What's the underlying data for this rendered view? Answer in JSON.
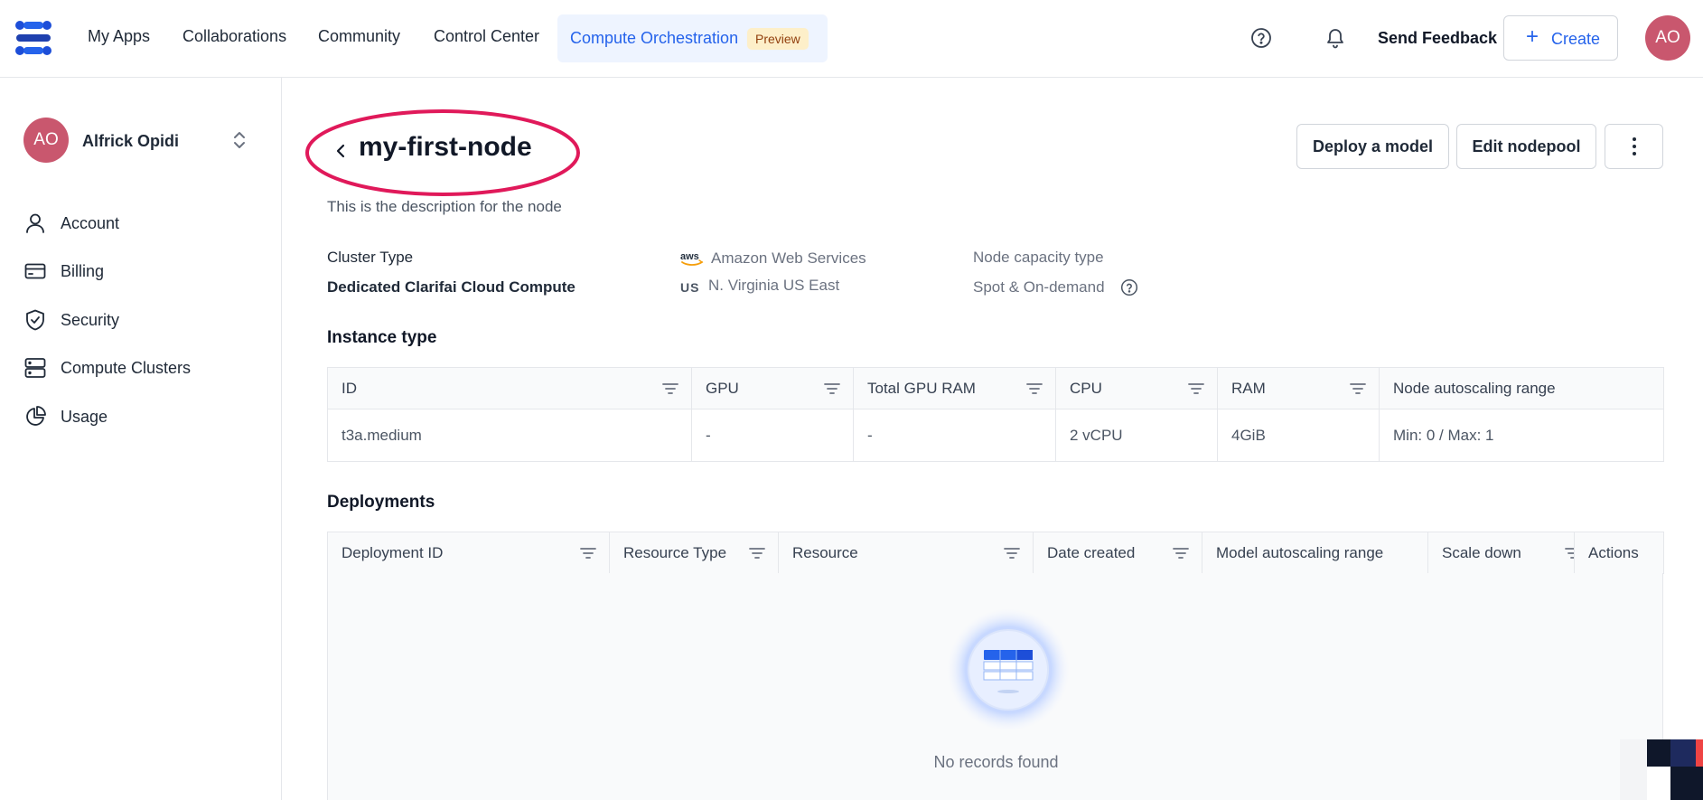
{
  "topnav": {
    "items": [
      "My Apps",
      "Collaborations",
      "Community",
      "Control Center"
    ],
    "active_item": "Compute Orchestration",
    "active_badge": "Preview",
    "send_feedback": "Send Feedback",
    "create_label": "Create",
    "avatar_initials": "AO"
  },
  "sidebar": {
    "avatar_initials": "AO",
    "user_name": "Alfrick Opidi",
    "items": [
      {
        "label": "Account",
        "icon": "user-icon"
      },
      {
        "label": "Billing",
        "icon": "credit-card-icon"
      },
      {
        "label": "Security",
        "icon": "shield-check-icon"
      },
      {
        "label": "Compute Clusters",
        "icon": "server-icon"
      },
      {
        "label": "Usage",
        "icon": "pie-chart-icon"
      }
    ]
  },
  "main": {
    "title": "my-first-node",
    "deploy_button": "Deploy a model",
    "edit_button": "Edit nodepool",
    "description": "This is the description for the node",
    "cluster_type_label": "Cluster Type",
    "cluster_type_value": "Dedicated Clarifai Cloud Compute",
    "provider": "Amazon Web Services",
    "provider_logo_text": "aws",
    "region_code": "US",
    "region": "N. Virginia US East",
    "capacity_label": "Node capacity type",
    "capacity_value": "Spot & On-demand",
    "instance_section": "Instance type",
    "instance_table": {
      "headers": [
        "ID",
        "GPU",
        "Total GPU RAM",
        "CPU",
        "RAM",
        "Node autoscaling range"
      ],
      "rows": [
        [
          "t3a.medium",
          "-",
          "-",
          "2 vCPU",
          "4GiB",
          "Min: 0 / Max: 1"
        ]
      ]
    },
    "deployments_section": "Deployments",
    "deployments_table": {
      "headers": [
        "Deployment ID",
        "Resource Type",
        "Resource",
        "Date created",
        "Model autoscaling range",
        "Scale down",
        "Actions"
      ]
    },
    "empty_message": "No records found"
  },
  "colors": {
    "accent": "#2563eb",
    "avatar": "#c9576e",
    "highlight_oval": "#e0195a",
    "badge_bg": "#fdefc9"
  }
}
